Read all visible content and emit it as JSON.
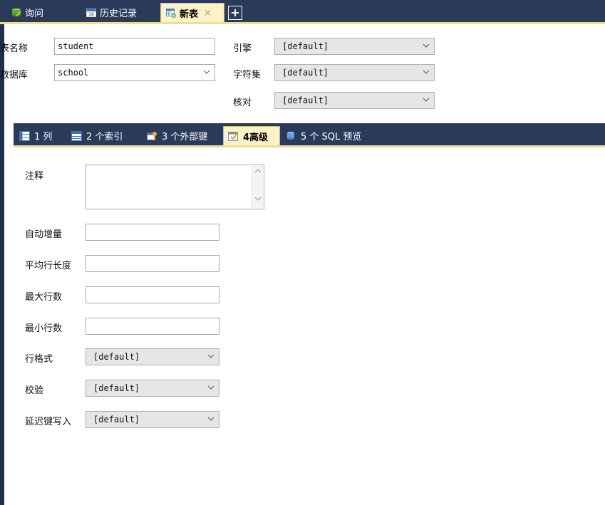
{
  "top_tabs": [
    {
      "label": "询问",
      "icon": "query-icon"
    },
    {
      "label": "历史记录",
      "icon": "calendar-icon"
    },
    {
      "label": "新表",
      "icon": "new-table-icon",
      "active": true,
      "close": "×"
    }
  ],
  "add_tab_label": "+",
  "table_form": {
    "name_label": "表名称",
    "name_value": "student",
    "database_label": "数据库",
    "database_value": "school",
    "engine_label": "引擎",
    "engine_value": "[default]",
    "charset_label": "字符集",
    "charset_value": "[default]",
    "collation_label": "核对",
    "collation_value": "[default]"
  },
  "sub_tabs": [
    {
      "label": "1 列",
      "icon": "columns-icon"
    },
    {
      "label": "2 个索引",
      "icon": "index-icon"
    },
    {
      "label": "3 个外部键",
      "icon": "foreign-key-icon"
    },
    {
      "label": "4高级",
      "icon": "advanced-icon",
      "active": true
    },
    {
      "label": "5 个 SQL 预览",
      "icon": "sql-preview-icon"
    }
  ],
  "advanced": {
    "comment_label": "注释",
    "comment_value": "",
    "auto_increment_label": "自动增量",
    "auto_increment_value": "",
    "avg_row_length_label": "平均行长度",
    "avg_row_length_value": "",
    "max_rows_label": "最大行数",
    "max_rows_value": "",
    "min_rows_label": "最小行数",
    "min_rows_value": "",
    "row_format_label": "行格式",
    "row_format_value": "[default]",
    "checksum_label": "校验",
    "checksum_value": "[default]",
    "delay_key_write_label": "延迟键写入",
    "delay_key_write_value": "[default]"
  },
  "colors": {
    "dark_bar": "#2a3b5a",
    "active_tab": "#fcf2c6",
    "accent_line": "#f3dc8c",
    "panel": "#ffffff"
  }
}
